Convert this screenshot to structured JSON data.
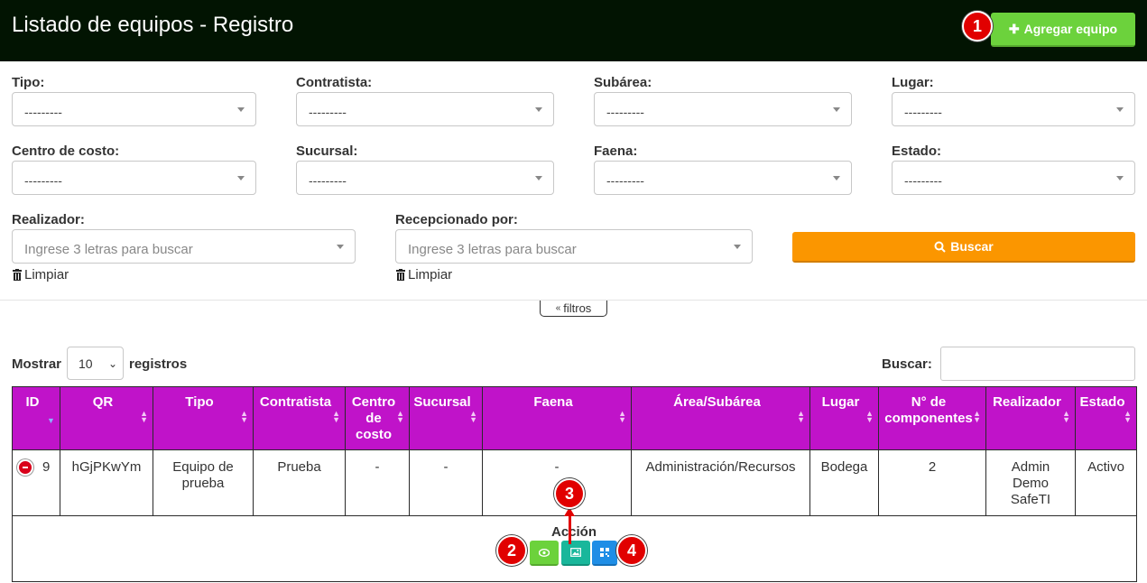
{
  "header": {
    "title": "Listado de equipos - Registro",
    "add_button": "Agregar equipo"
  },
  "callouts": [
    "1",
    "2",
    "3",
    "4"
  ],
  "filters": {
    "tipo": {
      "label": "Tipo:",
      "value": "---------"
    },
    "contratista": {
      "label": "Contratista:",
      "value": "---------"
    },
    "subarea": {
      "label": "Subárea:",
      "value": "---------"
    },
    "lugar": {
      "label": "Lugar:",
      "value": "---------"
    },
    "centro_costo": {
      "label": "Centro de costo:",
      "value": "---------"
    },
    "sucursal": {
      "label": "Sucursal:",
      "value": "---------"
    },
    "faena": {
      "label": "Faena:",
      "value": "---------"
    },
    "estado": {
      "label": "Estado:",
      "value": "---------"
    },
    "realizador": {
      "label": "Realizador:",
      "placeholder": "Ingrese 3 letras para buscar",
      "clear": "Limpiar"
    },
    "recepcionado": {
      "label": "Recepcionado por:",
      "placeholder": "Ingrese 3 letras para buscar",
      "clear": "Limpiar"
    },
    "search_button": "Buscar",
    "toggle_label": "filtros"
  },
  "table_controls": {
    "show_label": "Mostrar",
    "page_size": "10",
    "records_label": "registros",
    "search_label": "Buscar:"
  },
  "table": {
    "columns": [
      "ID",
      "QR",
      "Tipo",
      "Contratista",
      "Centro de costo",
      "Sucursal",
      "Faena",
      "Área/Subárea",
      "Lugar",
      "N° de componentes",
      "Realizador",
      "Estado"
    ],
    "rows": [
      {
        "id": "9",
        "qr": "hGjPKwYm",
        "tipo": "Equipo de prueba",
        "contratista": "Prueba",
        "centro_costo": "-",
        "sucursal": "-",
        "faena": "-",
        "area": "Administración/Recursos",
        "lugar": "Bodega",
        "componentes": "2",
        "realizador": "Admin Demo SafeTI",
        "estado": "Activo"
      }
    ],
    "detail": {
      "accion_label": "Acción"
    }
  },
  "colors": {
    "header_bg": "#021402",
    "table_header": "#c013c9",
    "add_green": "#6cd23c",
    "search_orange": "#fb9600",
    "callout_red": "#e10000"
  }
}
